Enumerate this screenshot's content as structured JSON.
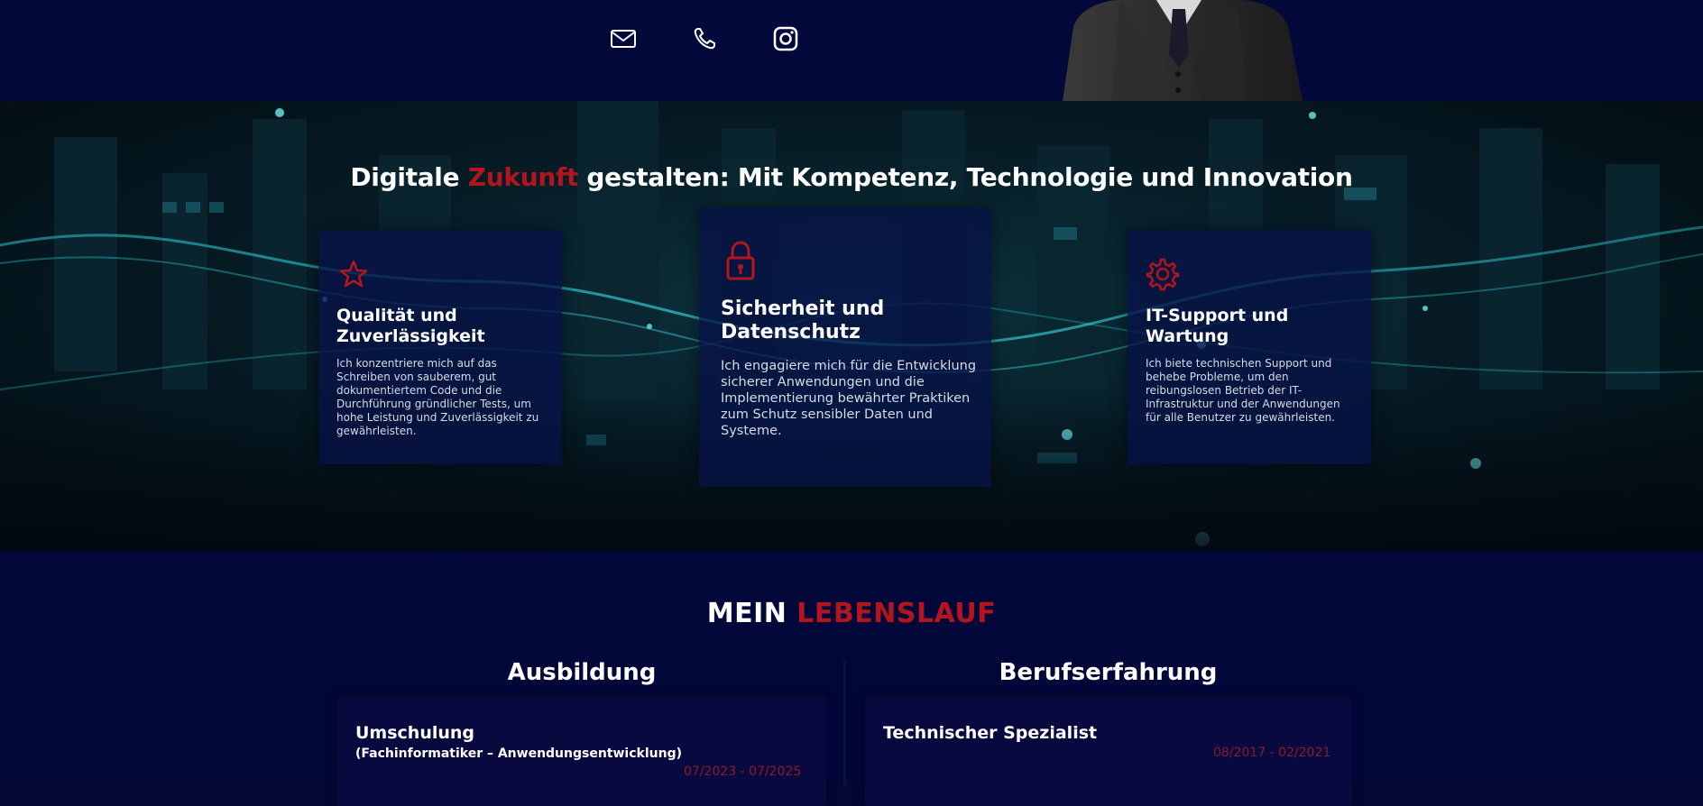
{
  "header": {
    "icons": [
      "mail-icon",
      "phone-icon",
      "instagram-icon"
    ]
  },
  "hero": {
    "title_part1": "Digitale ",
    "title_accent": "Zukunft",
    "title_part2": " gestalten: Mit Kompetenz, Technologie und Innovation",
    "cards": [
      {
        "icon": "star-icon",
        "title": "Qualität und Zuverlässigkeit",
        "text": "Ich konzentriere mich auf das Schreiben von sauberem, gut dokumentiertem Code und die Durchführung gründlicher Tests, um hohe Leistung und Zuverlässigkeit zu gewährleisten."
      },
      {
        "icon": "lock-icon",
        "title": "Sicherheit und Datenschutz",
        "text": "Ich engagiere mich für die Entwicklung sicherer Anwendungen und die Implementierung bewährter Praktiken zum Schutz sensibler Daten und Systeme."
      },
      {
        "icon": "gear-icon",
        "title": "IT-Support und Wartung",
        "text": "Ich biete technischen Support und behebe Probleme, um den reibungslosen Betrieb der IT-Infrastruktur und der Anwendungen für alle Benutzer zu gewährleisten."
      }
    ]
  },
  "cv": {
    "title_part1": "MEIN ",
    "title_accent": "LEBENSLAUF",
    "education": {
      "heading": "Ausbildung",
      "item_title": "Umschulung",
      "item_subtitle": "(Fachinformatiker – Anwendungsentwicklung)",
      "item_date": "07/2023 - 07/2025"
    },
    "experience": {
      "heading": "Berufserfahrung",
      "item_title": "Technischer Spezialist",
      "item_date": "08/2017 - 02/2021"
    }
  },
  "colors": {
    "accent_red": "#b3151f",
    "navy": "#02073a",
    "card_bg": "#061246"
  }
}
